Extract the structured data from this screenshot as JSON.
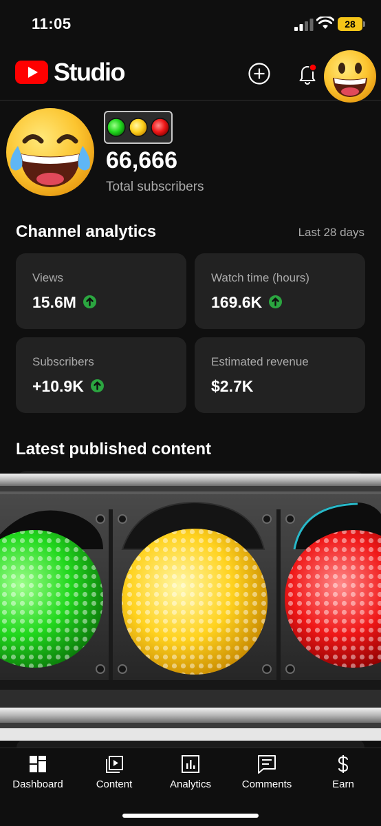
{
  "status_bar": {
    "time": "11:05",
    "battery": "28"
  },
  "header": {
    "brand": "Studio"
  },
  "channel": {
    "subscriber_count": "66,666",
    "subscriber_label": "Total subscribers"
  },
  "analytics": {
    "title": "Channel analytics",
    "period": "Last 28 days",
    "cards": [
      {
        "label": "Views",
        "value": "15.6M",
        "trend": "up"
      },
      {
        "label": "Watch time (hours)",
        "value": "169.6K",
        "trend": "up"
      },
      {
        "label": "Subscribers",
        "value": "+10.9K",
        "trend": "up"
      },
      {
        "label": "Estimated revenue",
        "value": "$2.7K",
        "trend": "none"
      }
    ]
  },
  "latest": {
    "title": "Latest published content"
  },
  "overlay": {
    "type": "traffic-light",
    "lights": [
      "green",
      "yellow",
      "red"
    ]
  },
  "nav": {
    "items": [
      {
        "label": "Dashboard",
        "icon": "dashboard-icon",
        "active": true
      },
      {
        "label": "Content",
        "icon": "content-icon"
      },
      {
        "label": "Analytics",
        "icon": "analytics-icon"
      },
      {
        "label": "Comments",
        "icon": "comments-icon"
      },
      {
        "label": "Earn",
        "icon": "dollar-icon"
      }
    ]
  },
  "colors": {
    "background": "#0f0f0f",
    "card": "#222222",
    "youtube_red": "#ff0000",
    "trend_green": "#2ba640",
    "battery_yellow": "#f5c518",
    "notification_dot": "#ff0000"
  }
}
